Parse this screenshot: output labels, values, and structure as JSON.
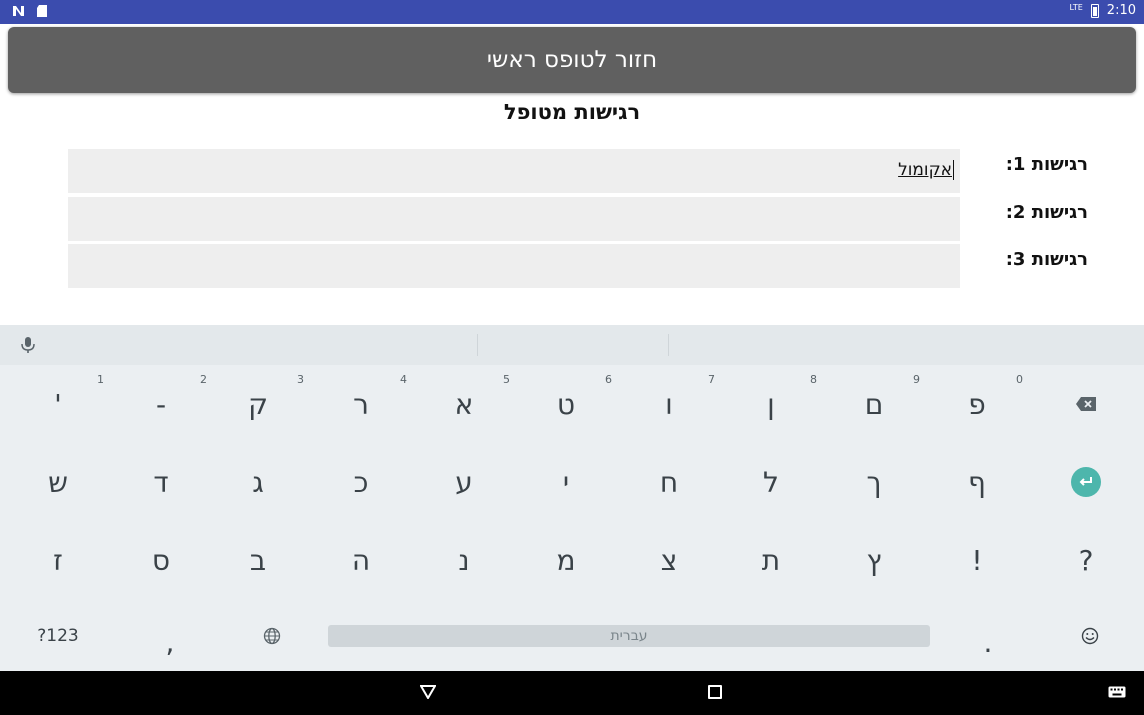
{
  "status_bar": {
    "time": "2:10",
    "network": "LTE",
    "icons": [
      "n-notification-icon",
      "sd-card-icon",
      "battery-icon"
    ]
  },
  "header": {
    "back_button_label": "חזור לטופס ראשי"
  },
  "form": {
    "title": "רגישות מטופל",
    "fields": [
      {
        "label": "רגישות 1:",
        "value": "אקומול"
      },
      {
        "label": "רגישות 2:",
        "value": ""
      },
      {
        "label": "רגישות 3:",
        "value": ""
      }
    ]
  },
  "keyboard": {
    "language_label": "עברית",
    "row1": [
      {
        "char": "'",
        "hint": "1"
      },
      {
        "char": "-",
        "hint": "2"
      },
      {
        "char": "ק",
        "hint": "3"
      },
      {
        "char": "ר",
        "hint": "4"
      },
      {
        "char": "א",
        "hint": "5"
      },
      {
        "char": "ט",
        "hint": "6"
      },
      {
        "char": "ו",
        "hint": "7"
      },
      {
        "char": "ן",
        "hint": "8"
      },
      {
        "char": "ם",
        "hint": "9"
      },
      {
        "char": "פ",
        "hint": "0"
      }
    ],
    "row2": [
      "ש",
      "ד",
      "ג",
      "כ",
      "ע",
      "י",
      "ח",
      "ל",
      "ך",
      "ף"
    ],
    "row3": [
      "ז",
      "ס",
      "ב",
      "ה",
      "נ",
      "מ",
      "צ",
      "ת",
      "ץ",
      "!",
      "?"
    ],
    "row4": {
      "symbols_label": "?123",
      "comma": ",",
      "period": "."
    },
    "accent_color": "#4db6ac"
  },
  "nav_bar": {
    "icons": [
      "back-triangle-icon",
      "home-square-icon",
      "keyboard-switch-icon"
    ]
  }
}
